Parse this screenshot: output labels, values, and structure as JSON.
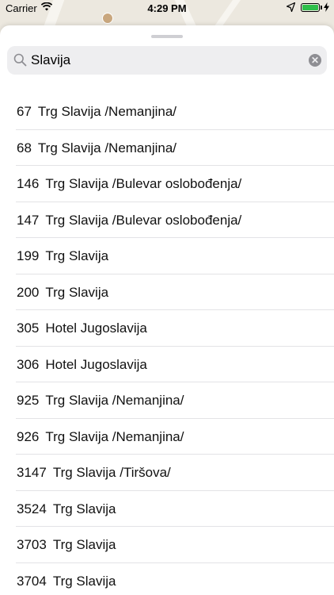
{
  "status_bar": {
    "carrier": "Carrier",
    "time": "4:29 PM",
    "battery_color": "#2fbf4a"
  },
  "search": {
    "value": "Slavija",
    "placeholder": "Search",
    "icon": "search-icon",
    "clear_icon": "clear-icon"
  },
  "results": [
    {
      "number": "67",
      "name": "Trg Slavija /Nemanjina/"
    },
    {
      "number": "68",
      "name": "Trg Slavija /Nemanjina/"
    },
    {
      "number": "146",
      "name": "Trg Slavija /Bulevar oslobođenja/"
    },
    {
      "number": "147",
      "name": "Trg Slavija /Bulevar oslobođenja/"
    },
    {
      "number": "199",
      "name": "Trg Slavija"
    },
    {
      "number": "200",
      "name": "Trg Slavija"
    },
    {
      "number": "305",
      "name": "Hotel Jugoslavija"
    },
    {
      "number": "306",
      "name": "Hotel Jugoslavija"
    },
    {
      "number": "925",
      "name": "Trg Slavija /Nemanjina/"
    },
    {
      "number": "926",
      "name": "Trg Slavija /Nemanjina/"
    },
    {
      "number": "3147",
      "name": "Trg Slavija /Tiršova/"
    },
    {
      "number": "3524",
      "name": "Trg Slavija"
    },
    {
      "number": "3703",
      "name": "Trg Slavija"
    },
    {
      "number": "3704",
      "name": "Trg Slavija"
    }
  ]
}
